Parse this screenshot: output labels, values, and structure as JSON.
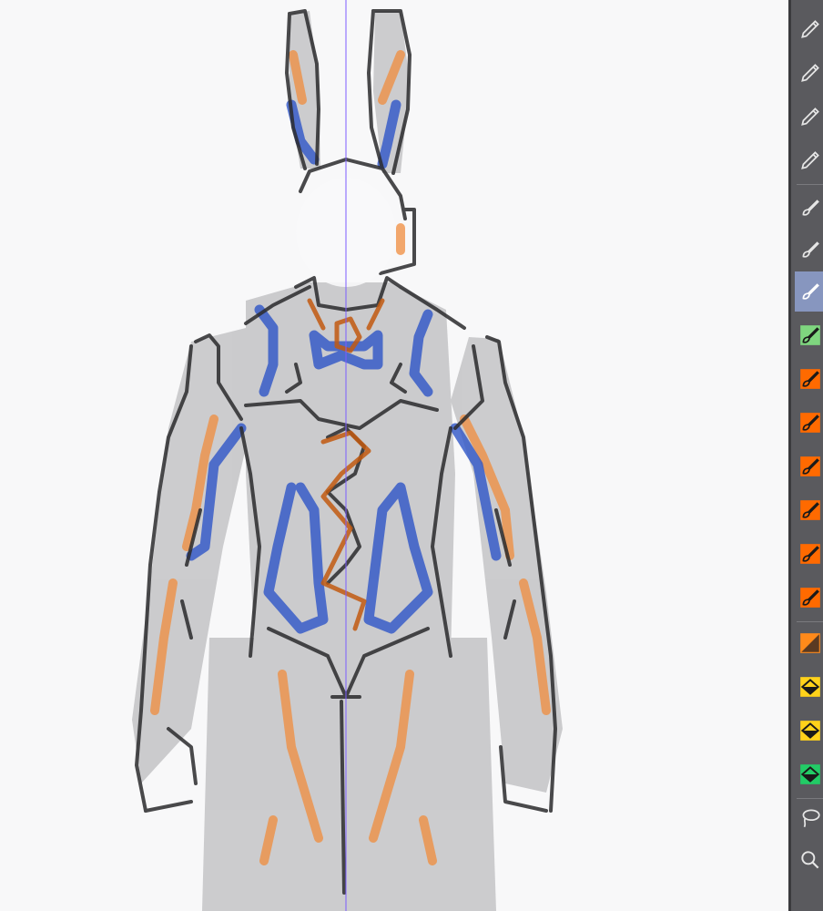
{
  "app": {
    "canvas": {
      "guide_color": "#7b5cff",
      "line_color": "#2b2b2d",
      "fill_color": "#c9c9cb",
      "accent_orange": "#f08c3c",
      "accent_blue": "#2e55c8"
    },
    "toolbar": {
      "background": "#5a5a5e",
      "active_index": 6,
      "tools": [
        {
          "icon": "pen-icon",
          "swatch": ""
        },
        {
          "icon": "pen-icon",
          "swatch": ""
        },
        {
          "icon": "pen-icon",
          "swatch": ""
        },
        {
          "icon": "pen-icon",
          "swatch": ""
        },
        {
          "icon": "brush-icon",
          "swatch": ""
        },
        {
          "icon": "brush-icon",
          "swatch": ""
        },
        {
          "icon": "brush-icon",
          "swatch": ""
        },
        {
          "icon": "brush-icon",
          "swatch": "#7fd67f"
        },
        {
          "icon": "brush-icon",
          "swatch": "#ff6a00"
        },
        {
          "icon": "brush-icon",
          "swatch": "#ff6a00"
        },
        {
          "icon": "brush-icon",
          "swatch": "#ff6a00"
        },
        {
          "icon": "brush-icon",
          "swatch": "#ff6a00"
        },
        {
          "icon": "brush-icon",
          "swatch": "#ff6a00"
        },
        {
          "icon": "brush-icon",
          "swatch": "#ff6a00"
        },
        {
          "icon": "eraser-icon",
          "swatch": "#ff8a1a"
        },
        {
          "icon": "fill-icon",
          "swatch": "#ffd21a"
        },
        {
          "icon": "fill-icon",
          "swatch": "#ffd21a"
        },
        {
          "icon": "fill-icon",
          "swatch": "#22cc66"
        },
        {
          "icon": "lasso-icon",
          "swatch": ""
        },
        {
          "icon": "zoom-icon",
          "swatch": ""
        }
      ]
    }
  }
}
